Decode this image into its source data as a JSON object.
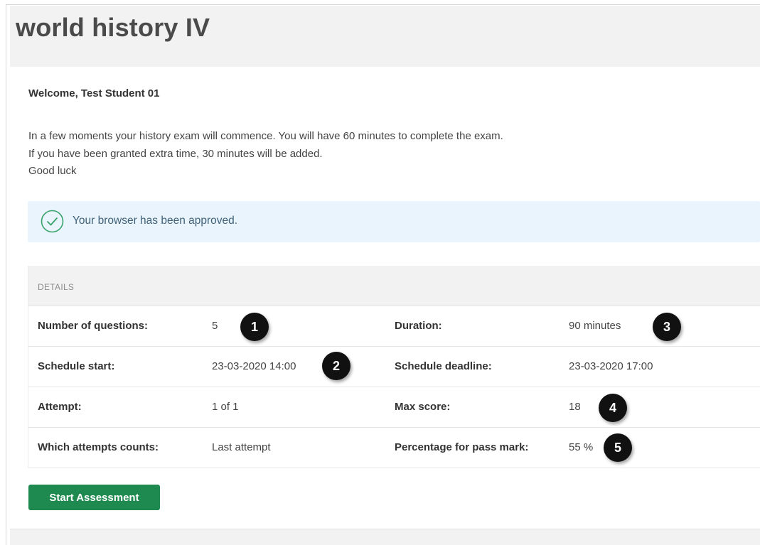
{
  "page": {
    "title": "world history IV"
  },
  "welcome": "Welcome, Test Student 01",
  "intro": {
    "line1": "In a few moments your history exam will commence. You will have 60 minutes to complete the exam.",
    "line2": "If you have been granted extra time, 30 minutes will be added.",
    "line3": "Good luck"
  },
  "alert": {
    "message": "Your browser has been approved.",
    "icon": "check-circle-icon",
    "color": "#3aa36b"
  },
  "details": {
    "heading": "DETAILS",
    "rows": [
      {
        "label_left": "Number of questions:",
        "value_left": "5",
        "label_right": "Duration:",
        "value_right": "90 minutes"
      },
      {
        "label_left": "Schedule start:",
        "value_left": "23-03-2020 14:00",
        "label_right": "Schedule deadline:",
        "value_right": "23-03-2020 17:00"
      },
      {
        "label_left": "Attempt:",
        "value_left": "1 of 1",
        "label_right": "Max score:",
        "value_right": "18"
      },
      {
        "label_left": "Which attempts counts:",
        "value_left": "Last attempt",
        "label_right": "Percentage for pass mark:",
        "value_right": "55 %"
      }
    ]
  },
  "callouts": [
    "1",
    "2",
    "3",
    "4",
    "5"
  ],
  "start_button": {
    "label": "Start Assessment",
    "color": "#1e8a50"
  }
}
